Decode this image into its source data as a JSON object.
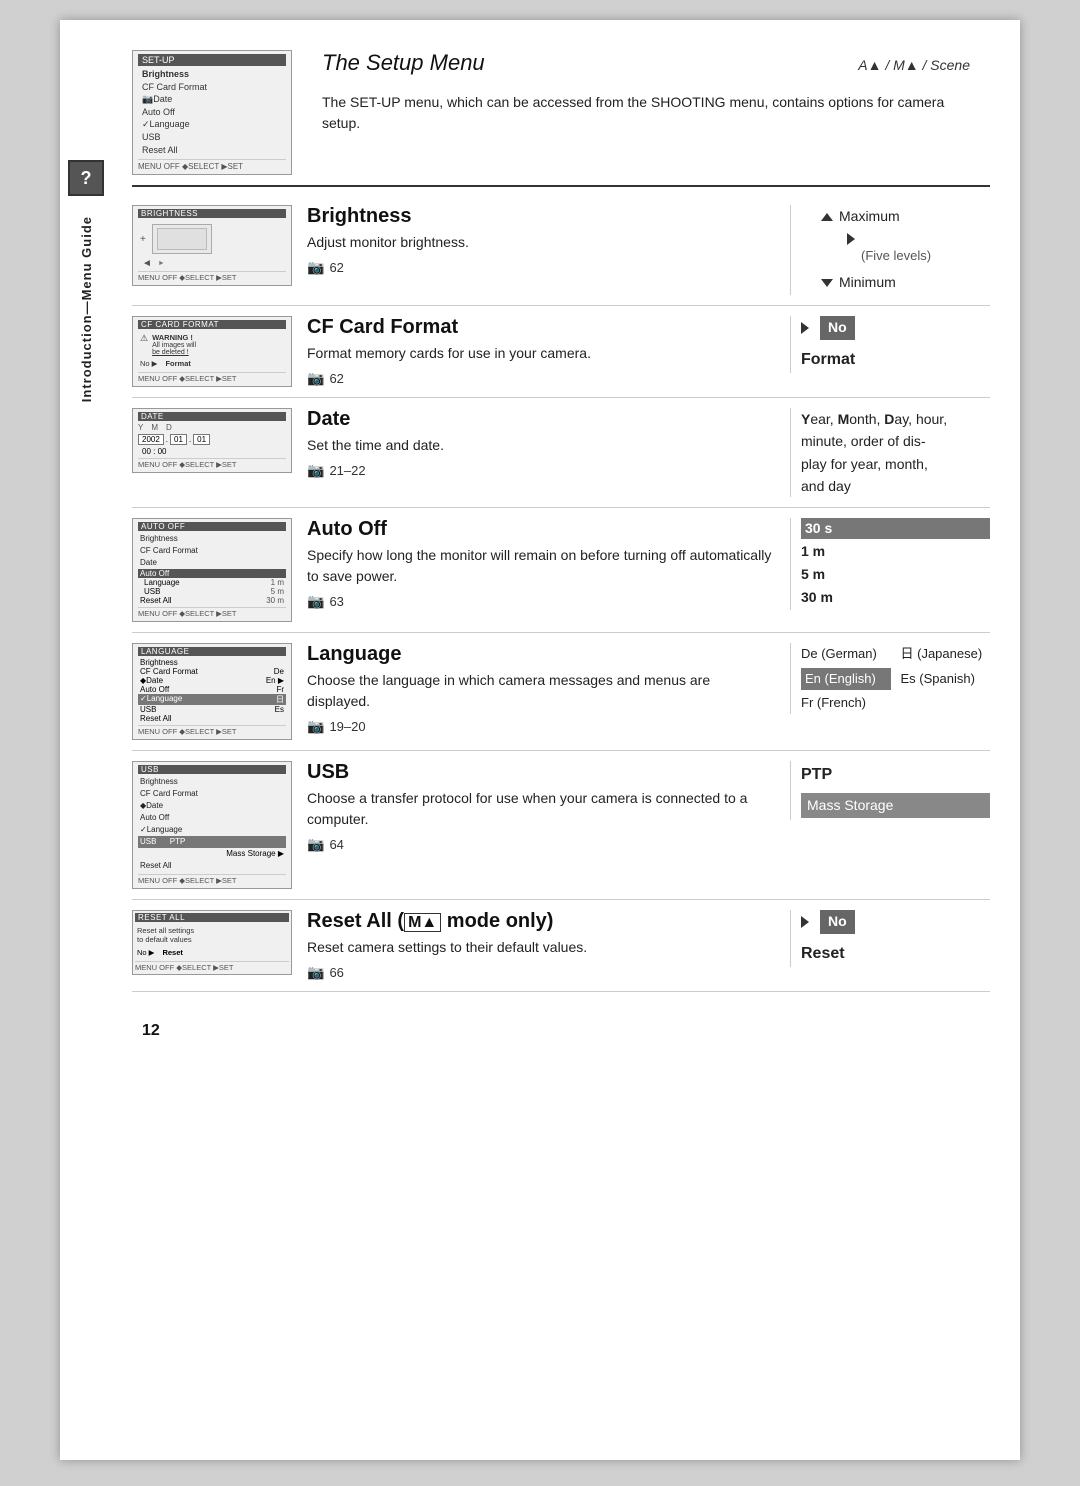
{
  "page": {
    "number": "12",
    "background": "#ffffff"
  },
  "side_tab": {
    "icon_label": "?",
    "text": "Introduction—Menu Guide"
  },
  "header": {
    "title": "The Setup Menu",
    "subtitle": "A▲ / M▲ / Scene",
    "description": "The SET-UP menu, which can be accessed from the SHOOTING menu, contains options for camera setup.",
    "menu_title": "SET-UP",
    "menu_items": [
      "Brightness",
      "CF Card Format",
      "Date",
      "Auto Off",
      "Language",
      "USB",
      "Reset All"
    ],
    "menu_controls": "MENU OFF  ◆SELECT  ▶SET"
  },
  "rows": [
    {
      "id": "brightness",
      "screen_title": "BRIGHTNESS",
      "title": "Brightness",
      "desc": "Adjust monitor brightness.",
      "page_ref": "62",
      "options_max": "Maximum",
      "options_paren": "(Five levels)",
      "options_min": "Minimum"
    },
    {
      "id": "cf-card-format",
      "screen_title": "CF CARD FORMAT",
      "title": "CF Card Format",
      "desc": "Format memory cards for use in your camera.",
      "page_ref": "62",
      "option_no": "No",
      "option_label": "Format"
    },
    {
      "id": "date",
      "screen_title": "DATE",
      "title": "Date",
      "desc": "Set the time and date.",
      "page_ref": "21–22",
      "options_text": "Year, Month, Day, hour, minute, order of display for year, month, and day"
    },
    {
      "id": "auto-off",
      "screen_title": "AUTO OFF",
      "title": "Auto Off",
      "desc": "Specify how long the monitor will remain on before turning off automatically to save power.",
      "page_ref": "63",
      "options": [
        "30 s",
        "1 m",
        "5 m",
        "30 m"
      ],
      "selected": "30 s"
    },
    {
      "id": "language",
      "screen_title": "LANGUAGE",
      "title": "Language",
      "desc": "Choose the language in which camera messages and menus are displayed.",
      "page_ref": "19–20",
      "options_col1": [
        "De (German)",
        "En (English)",
        "Fr (French)"
      ],
      "options_col2": [
        "日 (Japanese)",
        "Es (Spanish)"
      ],
      "selected": "En (English)"
    },
    {
      "id": "usb",
      "screen_title": "USB",
      "title": "USB",
      "desc": "Choose a transfer protocol for use when your camera is connected to a computer.",
      "page_ref": "64",
      "option_ptp": "PTP",
      "option_mass": "Mass Storage"
    },
    {
      "id": "reset-all",
      "screen_title": "RESET ALL",
      "title": "Reset All",
      "title_mode": "M▲ mode only",
      "desc": "Reset camera settings to their default values.",
      "page_ref": "66",
      "option_no": "No",
      "option_label": "Reset"
    }
  ]
}
